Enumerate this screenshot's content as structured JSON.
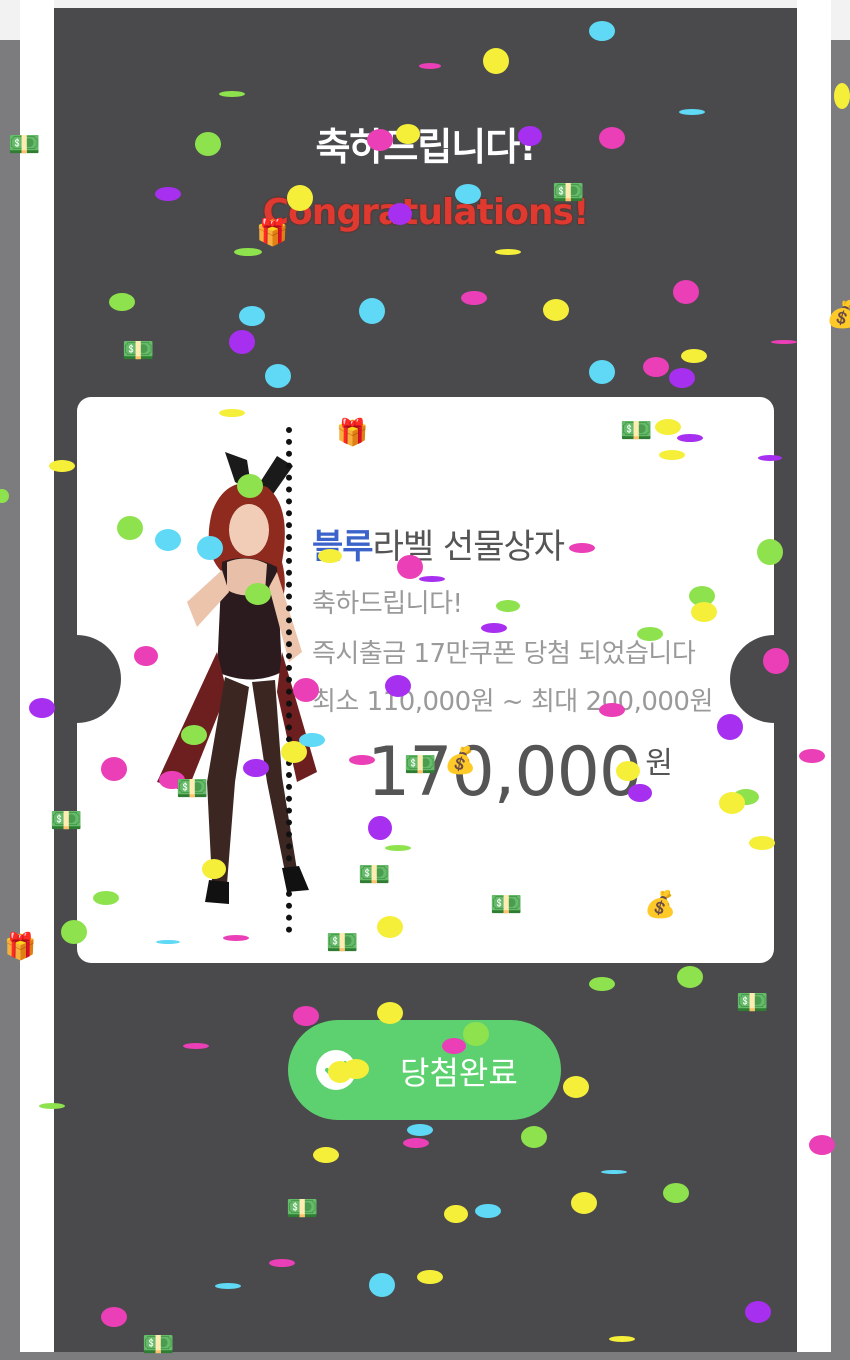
{
  "modal": {
    "title_ko": "축하드립니다!",
    "title_en": "Congratulations!"
  },
  "ticket": {
    "label_highlight": "블루",
    "label_rest": "라벨 선물상자",
    "line1": "축하드립니다!",
    "line2": "즉시출금 17만쿠폰 당첨 되었습니다",
    "line3": "최소 110,000원 ~ 최대 200,000원",
    "amount": "170,000",
    "unit": "원"
  },
  "button": {
    "label": "당첨완료"
  },
  "colors": {
    "overlay": "#4a4a4c",
    "accent_blue": "#3b63c9",
    "title_red": "#e0392f",
    "button_green": "#5dd16f"
  },
  "icons": [
    "check-icon",
    "money-bill-icon",
    "gift-icon",
    "money-bag-icon"
  ]
}
